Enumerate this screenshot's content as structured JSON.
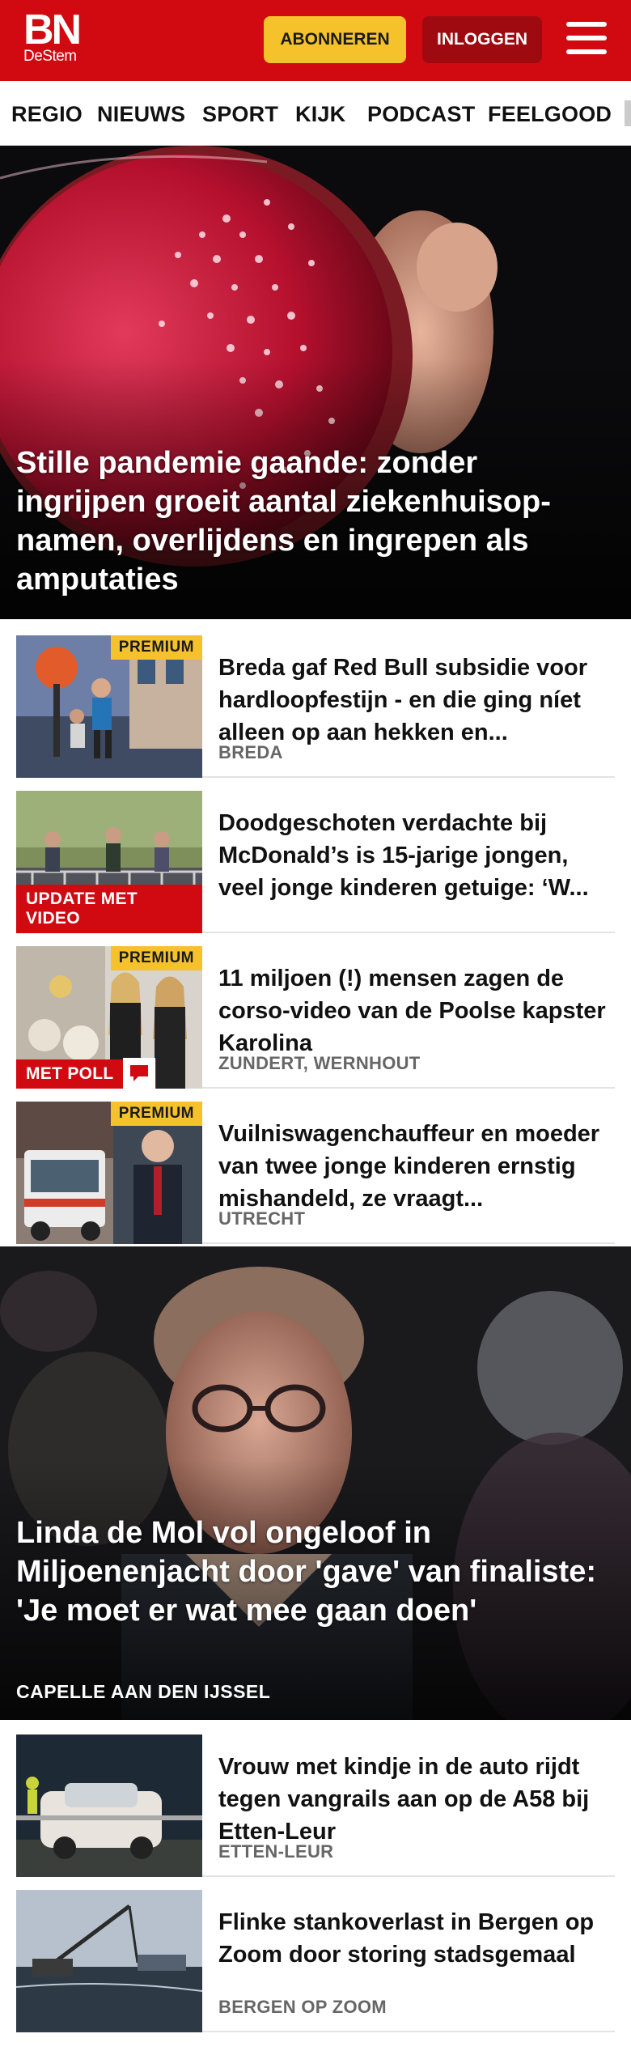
{
  "brand": {
    "logo_main": "BN",
    "logo_sub": "DeStem"
  },
  "header": {
    "subscribe_label": "ABONNEREN",
    "login_label": "INLOGGEN"
  },
  "nav": {
    "items": [
      "REGIO",
      "NIEUWS",
      "SPORT",
      "KIJK",
      "PODCAST",
      "FEELGOOD"
    ]
  },
  "hero1": {
    "title": "Stille pandemie gaande: zonder ingrijpen groeit aantal ziekenhuisop­namen, overlijdens en ingrepen als amputaties"
  },
  "articles1": [
    {
      "badge_premium": "PREMIUM",
      "title": "Breda gaf Red Bull subsidie voor hardloopfestijn - en die ging níet alleen op aan hekken en...",
      "location": "BREDA"
    },
    {
      "badge_red": "UPDATE MET VIDEO",
      "title": "Doodgeschoten verdachte bij McDonald’s is 15-jarige jongen, veel jonge kinderen getuige: ‘W..."
    },
    {
      "badge_premium": "PREMIUM",
      "badge_red": "MET POLL",
      "title": "11 miljoen (!) mensen zagen de corso-video van de Poolse kapster Karolina",
      "location": "ZUNDERT, WERNHOUT"
    },
    {
      "badge_premium": "PREMIUM",
      "title": "Vuilniswagenchauffeur en moeder van twee jonge kinderen ernstig mishandeld, ze vraagt...",
      "location": "UTRECHT"
    }
  ],
  "hero2": {
    "title": "Linda de Mol vol ongeloof in Miljoenenjacht door 'gave' van finaliste: 'Je moet er wat mee gaan doen'",
    "location": "CAPELLE AAN DEN IJSSEL"
  },
  "articles2": [
    {
      "title": "Vrouw met kindje in de auto rijdt tegen vangrails aan op de A58 bij Etten-Leur",
      "location": "ETTEN-LEUR"
    },
    {
      "title": "Flinke stankoverlast in Bergen op Zoom door storing stadsgemaal",
      "location": "BERGEN OP ZOOM"
    }
  ],
  "colors": {
    "brand_red": "#d10a11",
    "dark_red": "#9e0a10",
    "premium_yellow": "#f5c22c"
  }
}
